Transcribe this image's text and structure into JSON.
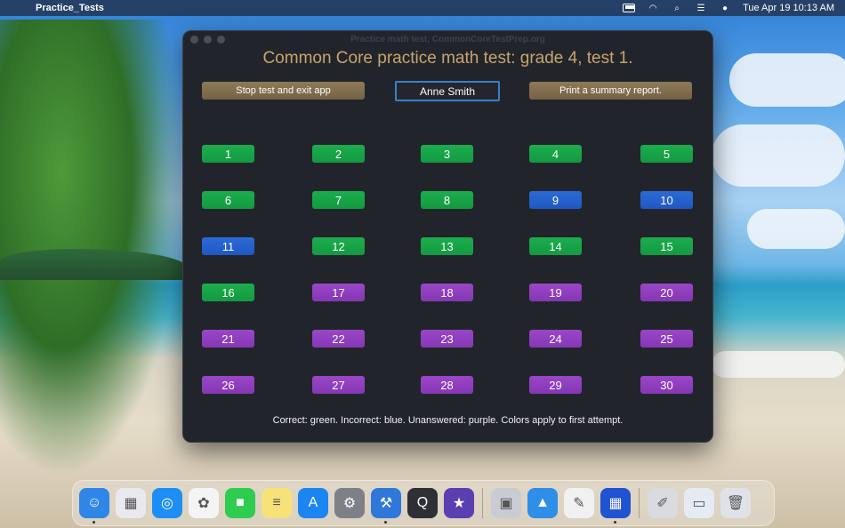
{
  "menubar": {
    "app_name": "Practice_Tests",
    "datetime": "Tue Apr 19  10:13 AM"
  },
  "window": {
    "title": "Practice math test, CommonCoreTestPrep.org",
    "heading": "Common Core practice math test: grade 4, test 1.",
    "stop_button": "Stop test and exit app",
    "name_value": "Anne Smith",
    "print_button": "Print a summary report.",
    "legend": "Correct: green. Incorrect: blue. Unanswered: purple. Colors apply to first attempt.",
    "status_colors": {
      "correct": "#1aa64a",
      "incorrect": "#2461cc",
      "unanswered": "#9040be"
    },
    "questions": [
      {
        "label": "1",
        "status": "correct"
      },
      {
        "label": "2",
        "status": "correct"
      },
      {
        "label": "3",
        "status": "correct"
      },
      {
        "label": "4",
        "status": "correct"
      },
      {
        "label": "5",
        "status": "correct"
      },
      {
        "label": "6",
        "status": "correct"
      },
      {
        "label": "7",
        "status": "correct"
      },
      {
        "label": "8",
        "status": "correct"
      },
      {
        "label": "9",
        "status": "incorrect"
      },
      {
        "label": "10",
        "status": "incorrect"
      },
      {
        "label": "11",
        "status": "incorrect"
      },
      {
        "label": "12",
        "status": "correct"
      },
      {
        "label": "13",
        "status": "correct"
      },
      {
        "label": "14",
        "status": "correct"
      },
      {
        "label": "15",
        "status": "correct"
      },
      {
        "label": "16",
        "status": "correct"
      },
      {
        "label": "17",
        "status": "unanswered"
      },
      {
        "label": "18",
        "status": "unanswered"
      },
      {
        "label": "19",
        "status": "unanswered"
      },
      {
        "label": "20",
        "status": "unanswered"
      },
      {
        "label": "21",
        "status": "unanswered"
      },
      {
        "label": "22",
        "status": "unanswered"
      },
      {
        "label": "23",
        "status": "unanswered"
      },
      {
        "label": "24",
        "status": "unanswered"
      },
      {
        "label": "25",
        "status": "unanswered"
      },
      {
        "label": "26",
        "status": "unanswered"
      },
      {
        "label": "27",
        "status": "unanswered"
      },
      {
        "label": "28",
        "status": "unanswered"
      },
      {
        "label": "29",
        "status": "unanswered"
      },
      {
        "label": "30",
        "status": "unanswered"
      }
    ]
  },
  "dock": {
    "items": [
      {
        "name": "finder-icon",
        "color": "#2f86e8",
        "glyph": "☺"
      },
      {
        "name": "launchpad-icon",
        "color": "#e9e9ee",
        "glyph": "▦"
      },
      {
        "name": "safari-icon",
        "color": "#1d8ef5",
        "glyph": "◎"
      },
      {
        "name": "photos-icon",
        "color": "#f4f4f4",
        "glyph": "✿"
      },
      {
        "name": "facetime-icon",
        "color": "#2ecc4f",
        "glyph": "■"
      },
      {
        "name": "notes-icon",
        "color": "#f7e27a",
        "glyph": "≡"
      },
      {
        "name": "app-store-icon",
        "color": "#1b86f2",
        "glyph": "A"
      },
      {
        "name": "system-preferences-icon",
        "color": "#7d8087",
        "glyph": "⚙"
      },
      {
        "name": "xcode-icon",
        "color": "#2f78d9",
        "glyph": "⚒"
      },
      {
        "name": "quicktime-icon",
        "color": "#2f3035",
        "glyph": "Q"
      },
      {
        "name": "imovie-icon",
        "color": "#5a3fb0",
        "glyph": "★"
      },
      {
        "name": "preview-icon",
        "color": "#c9ccd2",
        "glyph": "▣"
      },
      {
        "name": "instruments-icon",
        "color": "#2f8ee8",
        "glyph": "▲"
      },
      {
        "name": "textedit-icon",
        "color": "#f1f1f1",
        "glyph": "✎"
      },
      {
        "name": "practice-tests-app-icon",
        "color": "#1f53d0",
        "glyph": "▦"
      },
      {
        "name": "automator-icon",
        "color": "#d9dbe0",
        "glyph": "✐"
      },
      {
        "name": "downloads-folder-icon",
        "color": "#e4ebf3",
        "glyph": "▭"
      },
      {
        "name": "trash-icon",
        "color": "#dfe2e6",
        "glyph": "🗑"
      }
    ]
  }
}
